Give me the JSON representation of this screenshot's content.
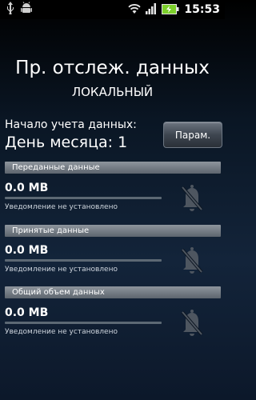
{
  "status_bar": {
    "time": "15:53",
    "icons": [
      "usb-icon",
      "android-debug-icon",
      "wifi-icon",
      "signal-icon",
      "battery-icon"
    ]
  },
  "header": {
    "title": "Пр. отслеж. данных",
    "subtitle": "ЛОКАЛЬНЫЙ"
  },
  "tracking_start": {
    "label": "Начало учета данных:",
    "value": "День месяца: 1",
    "button_label": "Парам."
  },
  "sections": [
    {
      "header": "Переданные данные",
      "value": "0.0 MB",
      "progress": 0,
      "notification": "Уведомление не установлено",
      "icon": "bell-muted-icon"
    },
    {
      "header": "Принятые данные",
      "value": "0.0 MB",
      "progress": 0,
      "notification": "Уведомление не установлено",
      "icon": "bell-muted-icon"
    },
    {
      "header": "Общий объем данных",
      "value": "0.0 MB",
      "progress": 0,
      "notification": "Уведомление не установлено",
      "icon": "bell-muted-icon"
    }
  ],
  "colors": {
    "battery": "#7ccf2a",
    "section_bar": "#7a828b",
    "progress_track": "#5c6874"
  }
}
